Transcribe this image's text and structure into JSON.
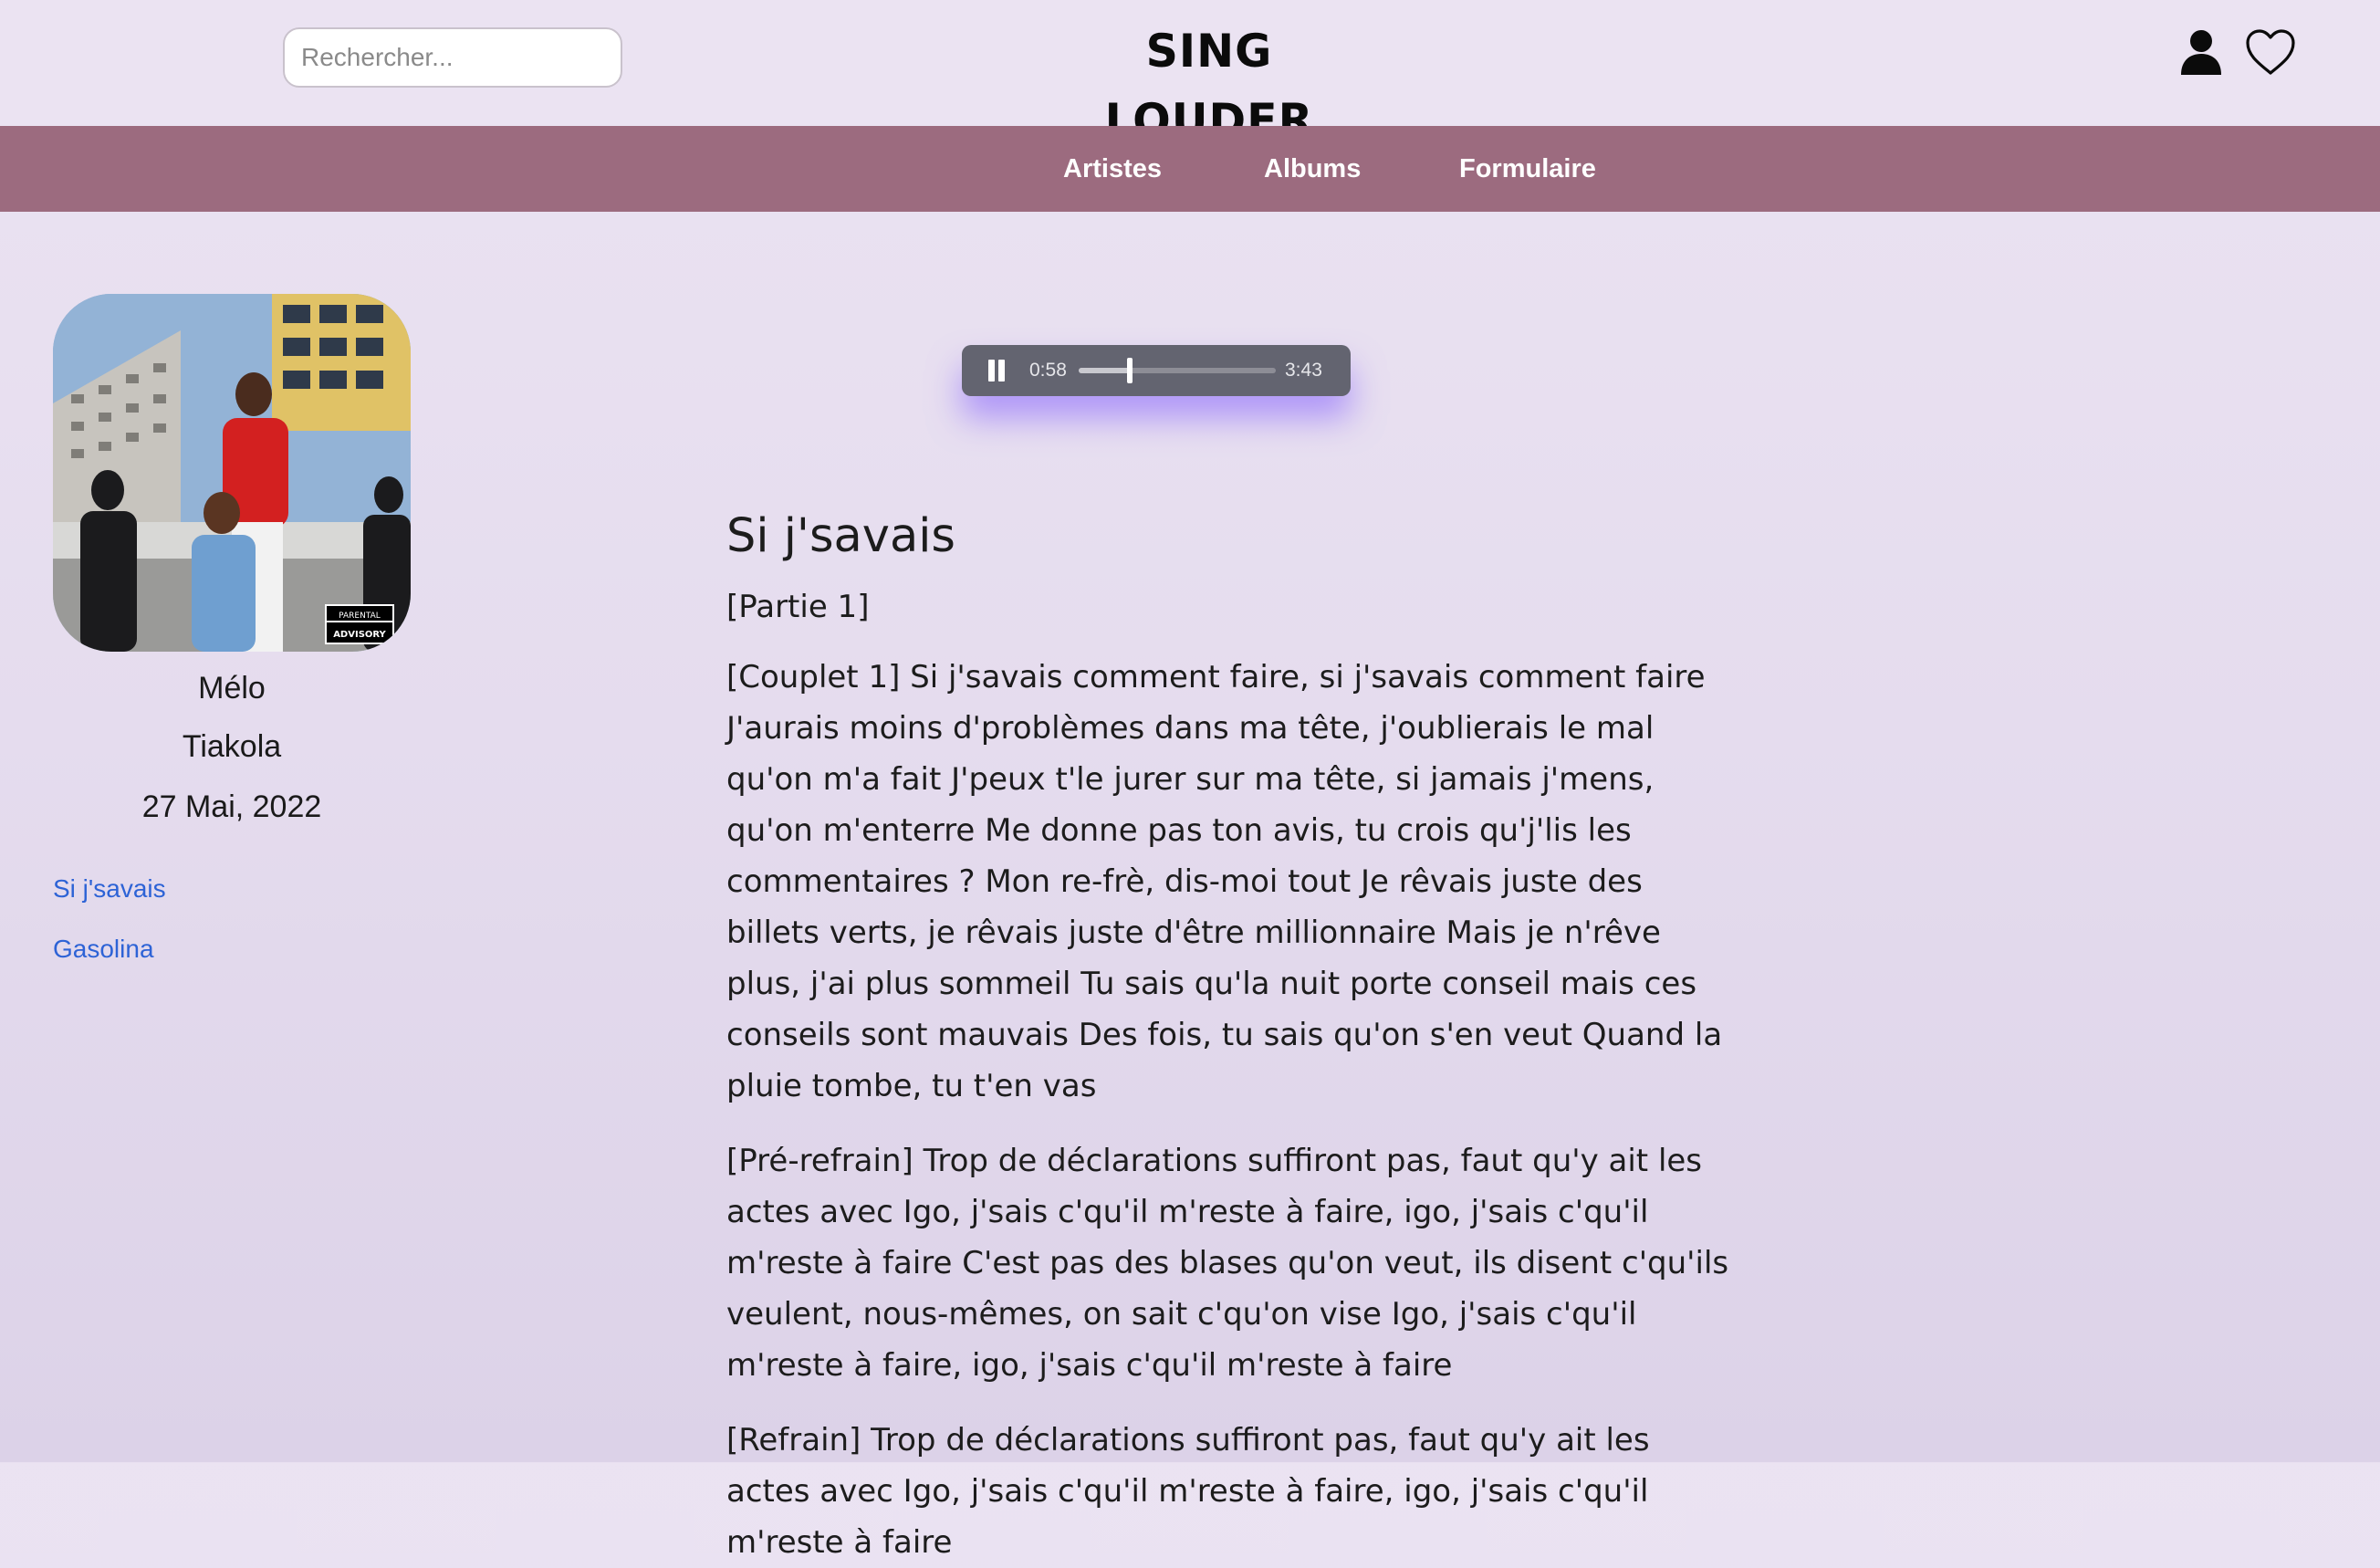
{
  "header": {
    "search_placeholder": "Rechercher...",
    "logo": "SING LOUDER"
  },
  "nav": {
    "items": [
      "Artistes",
      "Albums",
      "Formulaire"
    ]
  },
  "album": {
    "title": "Mélo",
    "artist": "Tiakola",
    "date": "27 Mai, 2022",
    "tracks": [
      "Si j'savais",
      "Gasolina"
    ],
    "cover_label": "PARENTAL ADVISORY EXPLICIT CONTENT"
  },
  "player": {
    "current_time": "0:58",
    "duration": "3:43",
    "progress": 0.26,
    "state": "playing"
  },
  "song": {
    "title": "Si j'savais",
    "part": "[Partie 1]",
    "verses": [
      "[Couplet 1] Si j'savais comment faire, si j'savais comment faire J'aurais moins d'problèmes dans ma tête, j'oublierais le mal qu'on m'a fait J'peux t'le jurer sur ma tête, si jamais j'mens, qu'on m'enterre Me donne pas ton avis, tu crois qu'j'lis les commentaires ? Mon re-frè, dis-moi tout Je rêvais juste des billets verts, je rêvais juste d'être millionnaire Mais je n'rêve plus, j'ai plus sommeil Tu sais qu'la nuit porte conseil mais ces conseils sont mauvais Des fois, tu sais qu'on s'en veut Quand la pluie tombe, tu t'en vas",
      "[Pré-refrain] Trop de déclarations suffiront pas, faut qu'y ait les actes avec Igo, j'sais c'qu'il m'reste à faire, igo, j'sais c'qu'il m'reste à faire C'est pas des blases qu'on veut, ils disent c'qu'ils veulent, nous-mêmes, on sait c'qu'on vise Igo, j'sais c'qu'il m'reste à faire, igo, j'sais c'qu'il m'reste à faire",
      "[Refrain] Trop de déclarations suffiront pas, faut qu'y ait les actes avec Igo, j'sais c'qu'il m'reste à faire, igo, j'sais c'qu'il m'reste à faire"
    ]
  },
  "colors": {
    "background": "#ebe3f2",
    "nav": "#9c6b7f",
    "link": "#2d63d6",
    "player": "#636470",
    "player_glow": "#8a5cff"
  }
}
